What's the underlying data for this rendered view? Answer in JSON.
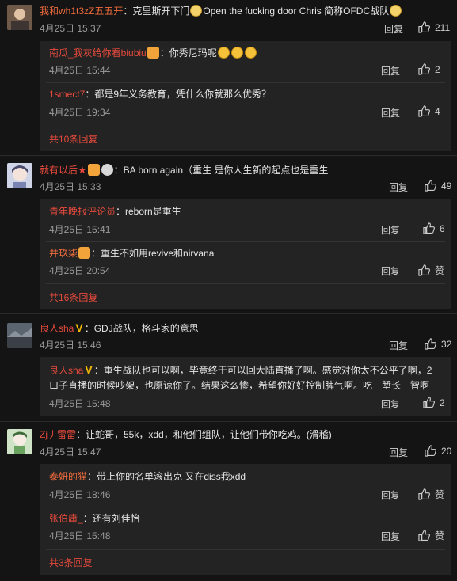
{
  "common": {
    "reply_label": "回复"
  },
  "comments": [
    {
      "user": "我和wh1t3zZ五五开",
      "text_a": "：克里斯开下门",
      "text_b": "Open the fucking door Chris   简称OFDC战队",
      "date": "4月25日 15:37",
      "likes": "211",
      "replies": [
        {
          "user": "南瓜_我灰给你看biubiu",
          "text": "：你秀尼玛呢",
          "date": "4月25日 15:44",
          "likes": "2"
        },
        {
          "user": "1smect7",
          "text": "：都是9年义务教育，凭什么你就那么优秀？",
          "date": "4月25日 19:34",
          "likes": "4"
        }
      ],
      "more": "共10条回复"
    },
    {
      "user": "就有以后",
      "text": "：BA born again（重生 是你人生新的起点也是重生",
      "date": "4月25日 15:33",
      "likes": "49",
      "replies": [
        {
          "user": "青年晚报评论员",
          "text": "：reborn是重生",
          "date": "4月25日 15:41",
          "likes": "6"
        },
        {
          "user": "井玖柒",
          "text": "：重生不如用revive和nirvana",
          "date": "4月25日 20:54",
          "likes": "赞"
        }
      ],
      "more": "共16条回复"
    },
    {
      "user": "良人sha",
      "text": "：GDJ战队，格斗家的意思",
      "date": "4月25日 15:46",
      "likes": "32",
      "replies": [
        {
          "user": "良人sha",
          "text": "：重生战队也可以啊，毕竟终于可以回大陆直播了啊。感觉对你太不公平了啊，2",
          "text2": "口子直播的时候吵架，也原谅你了。结果这么惨，希望你好好控制脾气啊。吃一堑长一智啊",
          "date": "4月25日 15:48",
          "likes": "2"
        }
      ]
    },
    {
      "user": "Zj丿雷雷",
      "text": "：让蛇哥，55k，xdd，和他们组队，让他们带你吃鸡。(滑稽)",
      "date": "4月25日 15:47",
      "likes": "20",
      "replies": [
        {
          "user": "泰妍的猫",
          "text": "：带上你的名单滚出克 又在diss我xdd",
          "date": "4月25日 18:46",
          "likes": "赞"
        },
        {
          "user": "张伯庸_",
          "text": "：还有刘佳怡",
          "date": "4月25日 15:48",
          "likes": "赞"
        }
      ],
      "more": "共3条回复"
    }
  ]
}
